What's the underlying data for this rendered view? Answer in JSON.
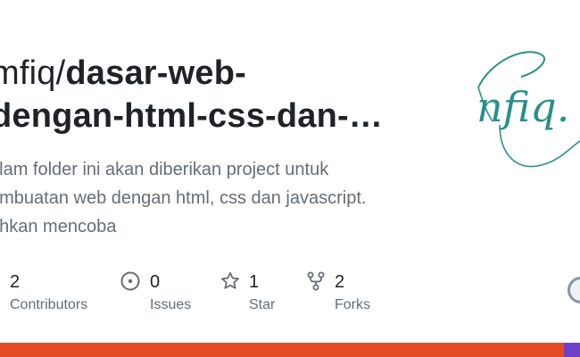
{
  "repo": {
    "owner_partial": "mfiq/",
    "name_line1": "dasar-web-",
    "name_line2": "dengan-html-css-dan-…",
    "description_lines": [
      "alam folder ini akan diberikan project untuk",
      "embuatan web dengan html, css dan javascript.",
      "ahkan mencoba"
    ],
    "logo_text": "nfiq."
  },
  "stats": {
    "contributors": {
      "value": "2",
      "label": "Contributors",
      "icon": "people-icon"
    },
    "issues": {
      "value": "0",
      "label": "Issues",
      "icon": "issue-circle-icon"
    },
    "stars": {
      "value": "1",
      "label": "Star",
      "icon": "star-icon"
    },
    "forks": {
      "value": "2",
      "label": "Forks",
      "icon": "fork-icon"
    }
  },
  "language_bar": [
    {
      "color": "#e34c26",
      "share": 0.972
    },
    {
      "color": "#6e40c9",
      "share": 0.028
    }
  ],
  "colors": {
    "logo": "#2a8f8a",
    "text": "#1f2328",
    "muted": "#656d76"
  }
}
